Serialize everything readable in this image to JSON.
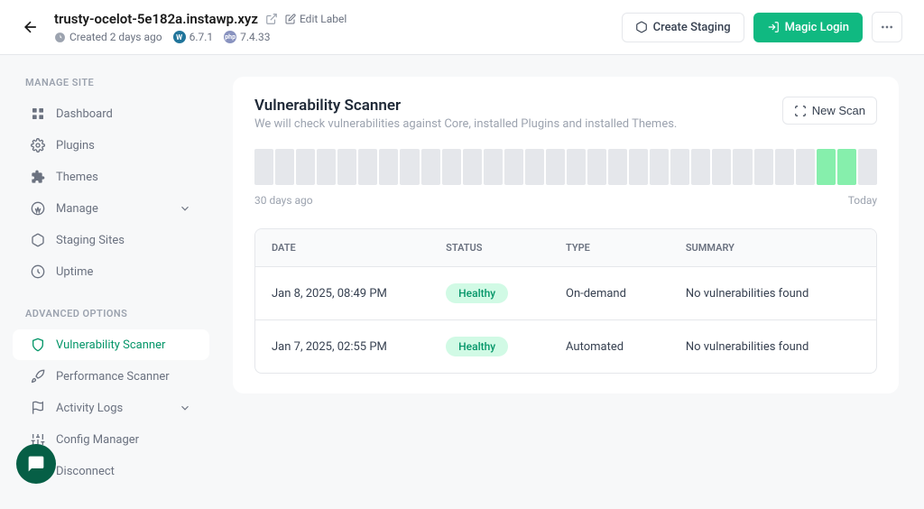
{
  "header": {
    "site_title": "trusty-ocelot-5e182a.instawp.xyz",
    "edit_label_text": "Edit Label",
    "created_text": "Created 2 days ago",
    "wp_version": "6.7.1",
    "php_version": "7.4.33",
    "create_staging_label": "Create Staging",
    "magic_login_label": "Magic Login"
  },
  "sidebar": {
    "section_manage": "MANAGE SITE",
    "section_advanced": "ADVANCED OPTIONS",
    "items": {
      "dashboard": "Dashboard",
      "plugins": "Plugins",
      "themes": "Themes",
      "manage": "Manage",
      "staging_sites": "Staging Sites",
      "uptime": "Uptime",
      "vulnerability_scanner": "Vulnerability Scanner",
      "performance_scanner": "Performance Scanner",
      "activity_logs": "Activity Logs",
      "config_manager": "Config Manager",
      "disconnect": "Disconnect"
    }
  },
  "scanner": {
    "title": "Vulnerability Scanner",
    "subtitle": "We will check vulnerabilities against Core, installed Plugins and installed Themes.",
    "new_scan_label": "New Scan",
    "chart_left": "30 days ago",
    "chart_right": "Today",
    "columns": {
      "date": "DATE",
      "status": "STATUS",
      "type": "TYPE",
      "summary": "SUMMARY"
    },
    "rows": [
      {
        "date": "Jan 8, 2025, 08:49 PM",
        "status": "Healthy",
        "type": "On-demand",
        "summary": "No vulnerabilities found"
      },
      {
        "date": "Jan 7, 2025, 02:55 PM",
        "status": "Healthy",
        "type": "Automated",
        "summary": "No vulnerabilities found"
      }
    ]
  }
}
